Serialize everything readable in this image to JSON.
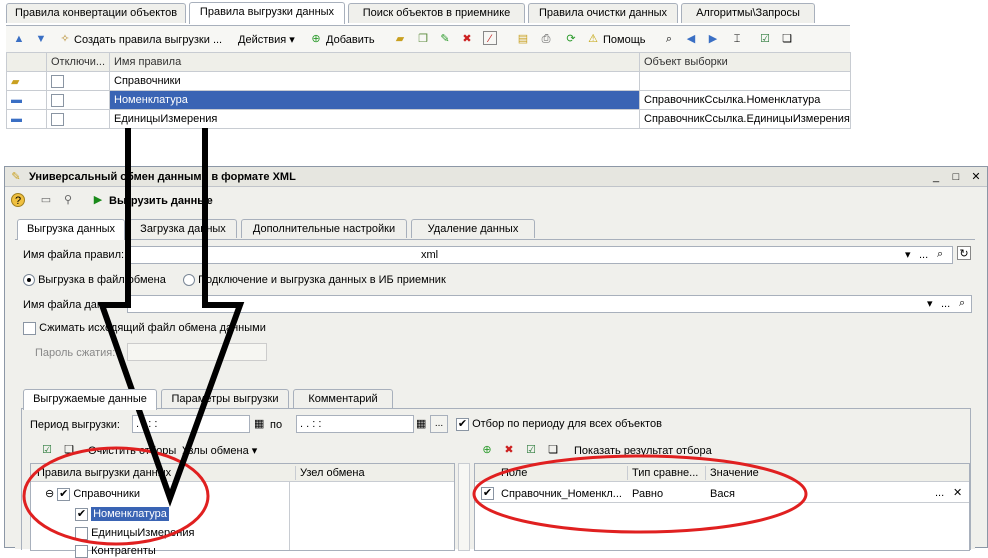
{
  "top": {
    "tabs": [
      "Правила конвертации объектов",
      "Правила выгрузки данных",
      "Поиск объектов в приемнике",
      "Правила очистки данных",
      "Алгоритмы\\Запросы"
    ],
    "toolbar": {
      "create": "Создать правила выгрузки ...",
      "actions": "Действия",
      "add": "Добавить",
      "help": "Помощь"
    },
    "columns": [
      "Отключи...",
      "Имя правила",
      "Объект выборки"
    ],
    "rows": [
      {
        "name": "Справочники",
        "object": ""
      },
      {
        "name": "Номенклатура",
        "object": "СправочникСсылка.Номенклатура"
      },
      {
        "name": "ЕдиницыИзмерения",
        "object": "СправочникСсылка.ЕдиницыИзмерения"
      }
    ]
  },
  "win": {
    "title": "Универсальный обмен данными в формате XML",
    "run": "Выгрузить данные",
    "tabs": [
      "Выгрузка данных",
      "Загрузка данных",
      "Дополнительные настройки",
      "Удаление данных"
    ],
    "rules_file_label": "Имя файла правил:",
    "rules_file_value": "xml",
    "radio1": "Выгрузка в файл обмена",
    "radio2": "Подключение и выгрузка данных в ИБ приемник",
    "data_file_label": "Имя файла данных:",
    "compress": "Сжимать исходящий файл обмена данными",
    "password": "Пароль сжатия:",
    "subtabs": [
      "Выгружаемые данные",
      "Параметры выгрузки",
      "Комментарий"
    ],
    "period_label": "Период выгрузки:",
    "date_mask": ". .   : :",
    "po": "по",
    "period_all": "Отбор по периоду для всех объектов",
    "sel_opts": "Очистить отборы",
    "nodes": "Узлы обмена",
    "tree_cols": [
      "Правила выгрузки данных",
      "Узел обмена"
    ],
    "tree": [
      "Справочники",
      "Номенклатура",
      "ЕдиницыИзмерения",
      "Контрагенты"
    ],
    "show_filter": "Показать результат отбора",
    "filter_cols": [
      "Поле",
      "Тип сравне...",
      "Значение"
    ],
    "filter_row": {
      "field": "Справочник_Номенкл...",
      "type": "Равно",
      "value": "Вася"
    }
  }
}
